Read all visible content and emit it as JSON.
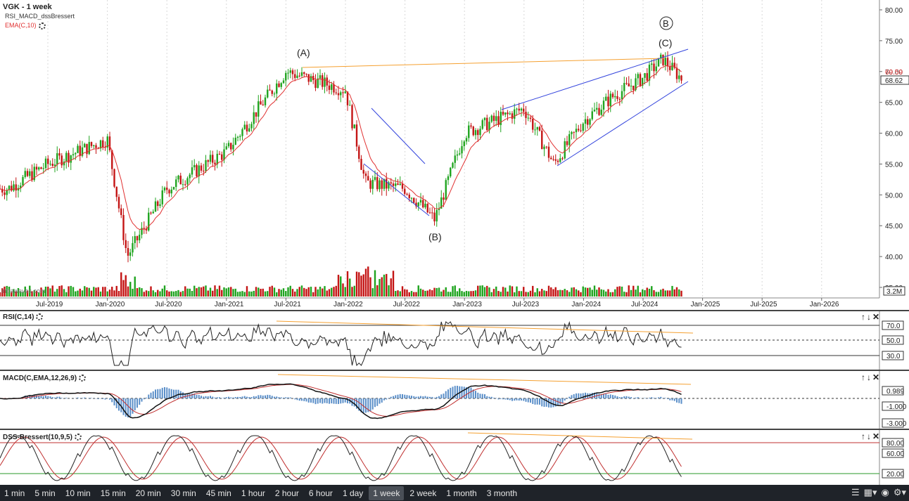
{
  "header": {
    "symbol": "VGK - 1 week",
    "study1": "RSI_MACD_dssBressert",
    "study2": "EMA(C,10)",
    "watermark": "intrawaves.com"
  },
  "price_axis": {
    "ticks": [
      "80.00",
      "75.00",
      "70.00",
      "65.00",
      "60.00",
      "55.00",
      "50.00",
      "45.00",
      "40.00",
      "35.00"
    ],
    "last_price": "68.62",
    "ema_value": "69.59",
    "volume_label": "3.2M"
  },
  "time_axis": [
    "Jul-2019",
    "Jan-2020",
    "Jul-2020",
    "Jan-2021",
    "Jul-2021",
    "Jan-2022",
    "Jul-2022",
    "Jan-2023",
    "Jul-2023",
    "Jan-2024",
    "Jul-2024",
    "Jan-2025",
    "Jul-2025",
    "Jan-2026"
  ],
  "wave_labels": {
    "a": "(A)",
    "b_low": "(B)",
    "c": "(C)",
    "b_circle": "B"
  },
  "panes": {
    "rsi": {
      "title": "RSI(C,14)",
      "ticks": [
        "70.0",
        "50.0",
        "30.0"
      ],
      "value": "50.0"
    },
    "macd": {
      "title": "MACD(C,EMA,12,26,9)",
      "ticks": [
        "0.989",
        "-1.000",
        "-3.000"
      ]
    },
    "dss": {
      "title": "DSS-Bressert(10,9,5)",
      "ticks": [
        "80.00",
        "60.00",
        "20.00"
      ]
    }
  },
  "pane_controls": "↑↓✕",
  "timeframes": [
    "1 min",
    "5 min",
    "10 min",
    "15 min",
    "20 min",
    "30 min",
    "45 min",
    "1 hour",
    "2 hour",
    "6 hour",
    "1 day",
    "1 week",
    "2 week",
    "1 month",
    "3 month"
  ],
  "active_timeframe": "1 week",
  "colors": {
    "up": "#1fa41f",
    "down": "#c41414",
    "ema": "#e03030",
    "channel": "#3344dd",
    "trend": "#f5a030",
    "bar_bg": "#1f2329"
  },
  "chart_data": {
    "type": "candlestick",
    "x": [
      "2019-03",
      "2019-07",
      "2020-01",
      "2020-03",
      "2020-07",
      "2021-01",
      "2021-07",
      "2021-09",
      "2022-01",
      "2022-03",
      "2022-07",
      "2022-10",
      "2023-01",
      "2023-07",
      "2023-10",
      "2024-01",
      "2024-04",
      "2024-07",
      "2024-09",
      "2024-11"
    ],
    "close": [
      51,
      55,
      59,
      40,
      51,
      57,
      70,
      69,
      67,
      52,
      51,
      46,
      60,
      64,
      55,
      62,
      66,
      69,
      72,
      68.62
    ],
    "ylim": [
      35,
      80
    ]
  }
}
